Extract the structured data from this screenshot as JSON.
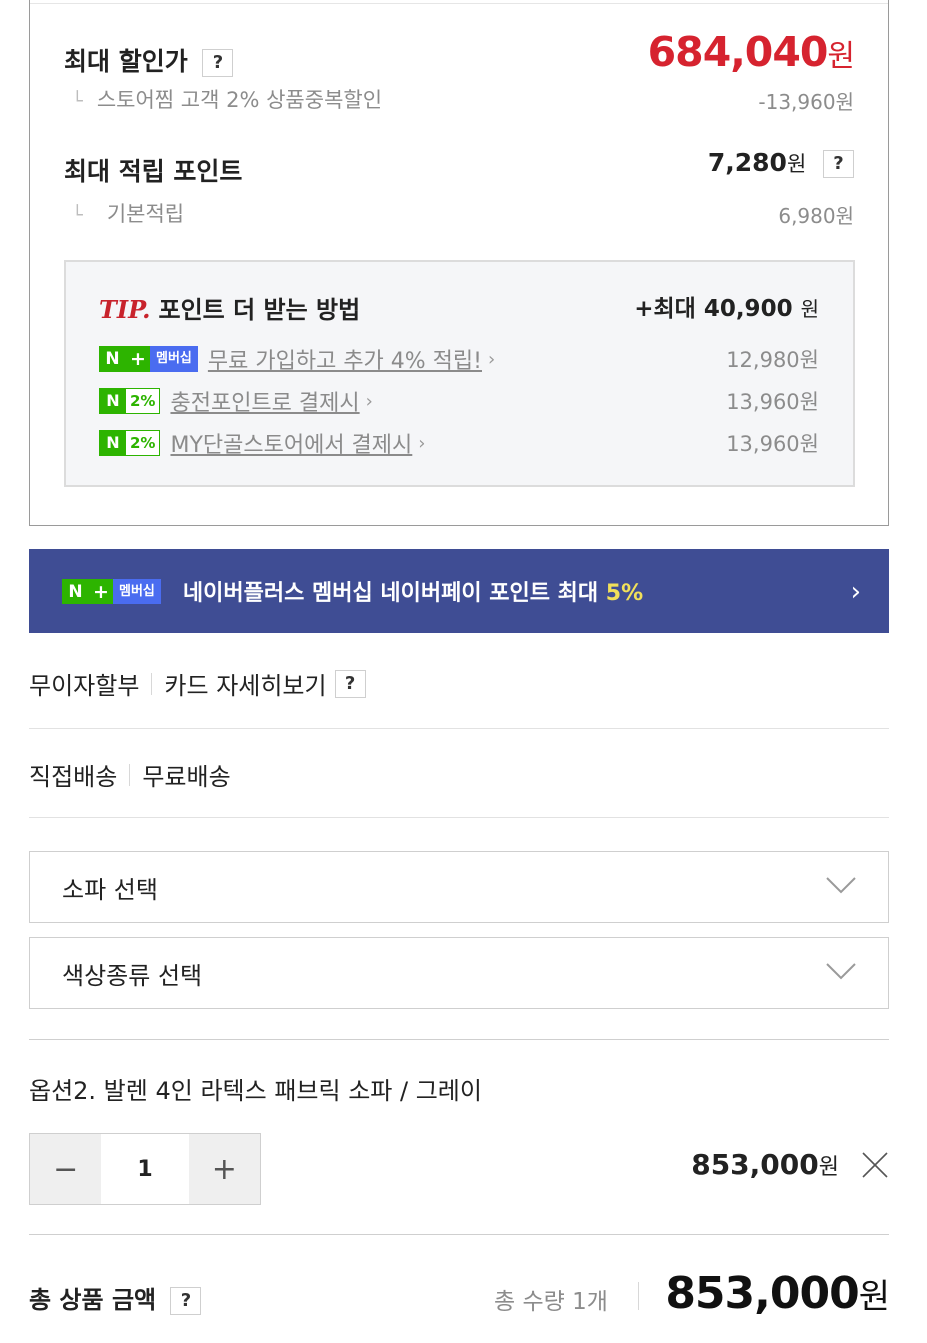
{
  "benefits": {
    "max_discount_label": "최대 할인가",
    "max_discount_price": "684,040",
    "won": "원",
    "discount_detail_label": "스토어찜 고객 2% 상품중복할인",
    "discount_detail_amount": "-13,960원",
    "max_point_label": "최대 적립 포인트",
    "max_point_value": "7,280",
    "basic_point_label": "기본적립",
    "basic_point_amount": "6,980원",
    "help_mark": "?"
  },
  "tip": {
    "tip_word": "TIP.",
    "title": "포인트 더 받는 방법",
    "max_amount": "+최대 40,900",
    "won": "원",
    "items": [
      {
        "badge_type": "nplus-membership",
        "badge_n": "N",
        "badge_plus": "+",
        "badge_text": "멤버십",
        "link": "무료 가입하고 추가 4% 적립!",
        "amount": "12,980원"
      },
      {
        "badge_type": "npay-2pct",
        "badge_n": "N",
        "badge_text": "2%",
        "link": "충전포인트로 결제시",
        "amount": "13,960원"
      },
      {
        "badge_type": "npay-2pct",
        "badge_n": "N",
        "badge_text": "2%",
        "link": "MY단골스토어에서 결제시",
        "amount": "13,960원"
      }
    ]
  },
  "banner": {
    "badge_n": "N",
    "badge_plus": "+",
    "badge_text": "멤버십",
    "text": "네이버플러스 멤버십 네이버페이 포인트 최대",
    "highlight": "5%",
    "arrow": "›"
  },
  "payment": {
    "installment": "무이자할부",
    "card_detail": "카드 자세히보기",
    "help_mark": "?"
  },
  "shipping": {
    "method": "직접배송",
    "fee": "무료배송"
  },
  "selects": [
    {
      "label": "소파 선택"
    },
    {
      "label": "색상종류 선택"
    }
  ],
  "selected_option": {
    "title": "옵션2. 발렌 4인 라텍스 패브릭 소파 / 그레이",
    "minus": "−",
    "quantity": "1",
    "plus": "+",
    "price": "853,000",
    "won": "원"
  },
  "total": {
    "label": "총 상품 금액",
    "help_mark": "?",
    "quantity_text": "총 수량 1개",
    "price": "853,000",
    "won": "원"
  },
  "colors": {
    "price_red": "#d6232f",
    "naver_green": "#2db400",
    "membership_blue": "#4a6cf0",
    "banner_bg": "#3f4d94",
    "highlight_yellow": "#f1e05a"
  }
}
